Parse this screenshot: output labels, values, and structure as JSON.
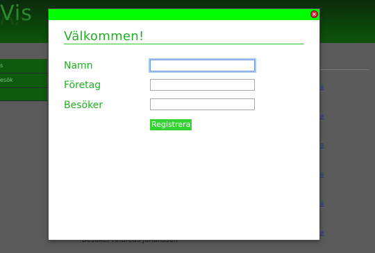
{
  "app": {
    "logo": "Vis"
  },
  "sidebar": {
    "items": [
      {
        "label": "s"
      },
      {
        "label": "esök"
      }
    ]
  },
  "background": {
    "links": [
      "a",
      "a",
      "a",
      "a",
      "a",
      "a"
    ],
    "bottom_text": "Besöker Andreas Johansson"
  },
  "modal": {
    "title": "Välkommen!",
    "fields": [
      {
        "label": "Namn",
        "value": "",
        "focused": true
      },
      {
        "label": "Företag",
        "value": ""
      },
      {
        "label": "Besöker",
        "value": ""
      }
    ],
    "submit_label": "Registrera",
    "close_icon": "close-icon",
    "colors": {
      "bar": "#00ff00",
      "accent": "#22b022",
      "button": "#34d334"
    }
  }
}
